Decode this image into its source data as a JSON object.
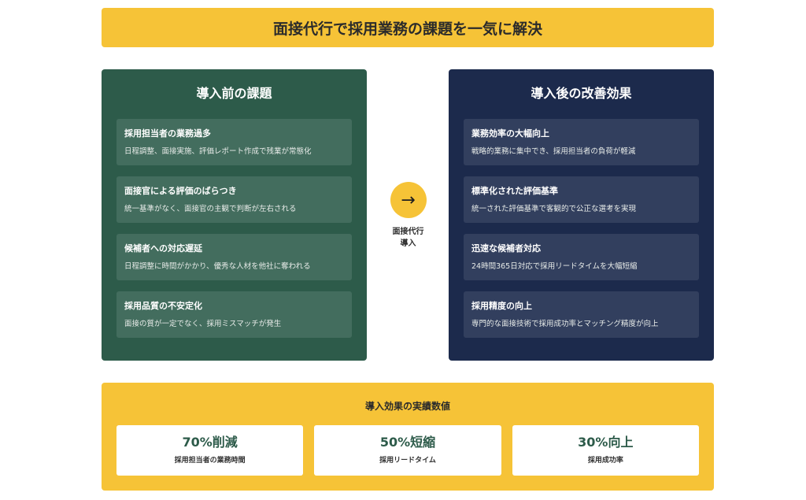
{
  "title": "面接代行で採用業務の課題を一気に解決",
  "before": {
    "title": "導入前の課題",
    "cards": [
      {
        "title": "採用担当者の業務過多",
        "desc": "日程調整、面接実施、評価レポート作成で残業が常態化"
      },
      {
        "title": "面接官による評価のばらつき",
        "desc": "統一基準がなく、面接官の主観で判断が左右される"
      },
      {
        "title": "候補者への対応遅延",
        "desc": "日程調整に時間がかかり、優秀な人材を他社に奪われる"
      },
      {
        "title": "採用品質の不安定化",
        "desc": "面接の質が一定でなく、採用ミスマッチが発生"
      }
    ]
  },
  "after": {
    "title": "導入後の改善効果",
    "cards": [
      {
        "title": "業務効率の大幅向上",
        "desc": "戦略的業務に集中でき、採用担当者の負荷が軽減"
      },
      {
        "title": "標準化された評価基準",
        "desc": "統一された評価基準で客観的で公正な選考を実現"
      },
      {
        "title": "迅速な候補者対応",
        "desc": "24時間365日対応で採用リードタイムを大幅短縮"
      },
      {
        "title": "採用精度の向上",
        "desc": "専門的な面接技術で採用成功率とマッチング精度が向上"
      }
    ]
  },
  "arrow": {
    "icon": "→",
    "label": "面接代行\n導入"
  },
  "results": {
    "title": "導入効果の実績数値",
    "metrics": [
      {
        "value": "70%削減",
        "label": "採用担当者の業務時間"
      },
      {
        "value": "50%短縮",
        "label": "採用リードタイム"
      },
      {
        "value": "30%向上",
        "label": "採用成功率"
      }
    ]
  },
  "colors": {
    "accent": "#f6c337",
    "before_panel": "#2d5b4a",
    "after_panel": "#1c2a4c"
  }
}
